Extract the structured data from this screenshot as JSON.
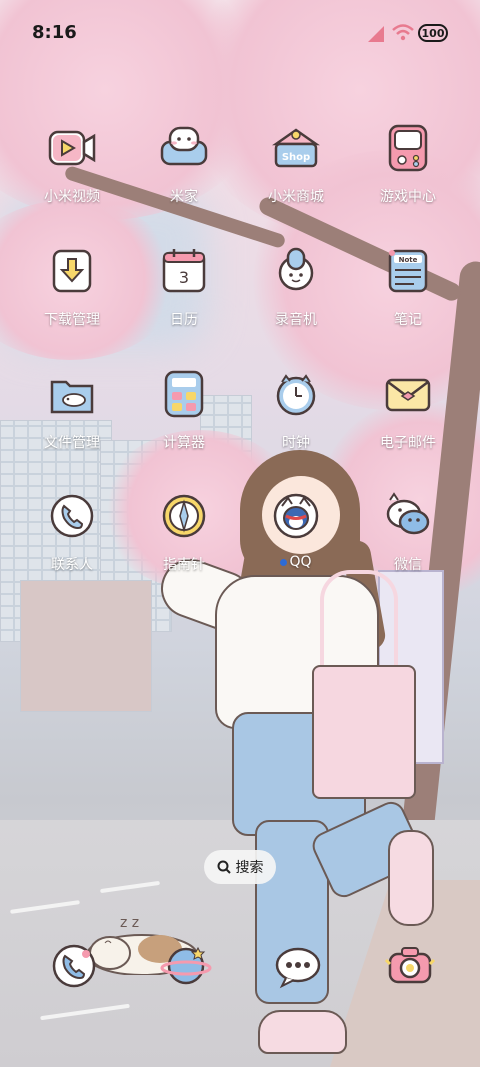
{
  "status_bar": {
    "time": "8:16",
    "battery": "100"
  },
  "home": {
    "apps": [
      {
        "label": "小米视频",
        "icon": "video-icon"
      },
      {
        "label": "米家",
        "icon": "sofa-icon"
      },
      {
        "label": "小米商城",
        "icon": "shop-icon"
      },
      {
        "label": "游戏中心",
        "icon": "game-console-icon"
      },
      {
        "label": "下载管理",
        "icon": "download-icon"
      },
      {
        "label": "日历",
        "icon": "calendar-icon"
      },
      {
        "label": "录音机",
        "icon": "recorder-icon"
      },
      {
        "label": "笔记",
        "icon": "note-icon"
      },
      {
        "label": "文件管理",
        "icon": "folder-icon"
      },
      {
        "label": "计算器",
        "icon": "calculator-icon"
      },
      {
        "label": "时钟",
        "icon": "clock-icon"
      },
      {
        "label": "电子邮件",
        "icon": "mail-icon"
      },
      {
        "label": "联系人",
        "icon": "phone-icon"
      },
      {
        "label": "指南针",
        "icon": "compass-icon"
      },
      {
        "label": "QQ",
        "icon": "qq-penguin-icon"
      },
      {
        "label": "微信",
        "icon": "wechat-icon"
      }
    ],
    "calendar_day": "3",
    "note_icon_text": "Note",
    "shop_icon_text": "Shop",
    "search_label": "搜索",
    "dock": [
      {
        "icon": "phone-icon"
      },
      {
        "icon": "browser-planet-icon"
      },
      {
        "icon": "messages-icon"
      },
      {
        "icon": "camera-icon"
      }
    ]
  }
}
